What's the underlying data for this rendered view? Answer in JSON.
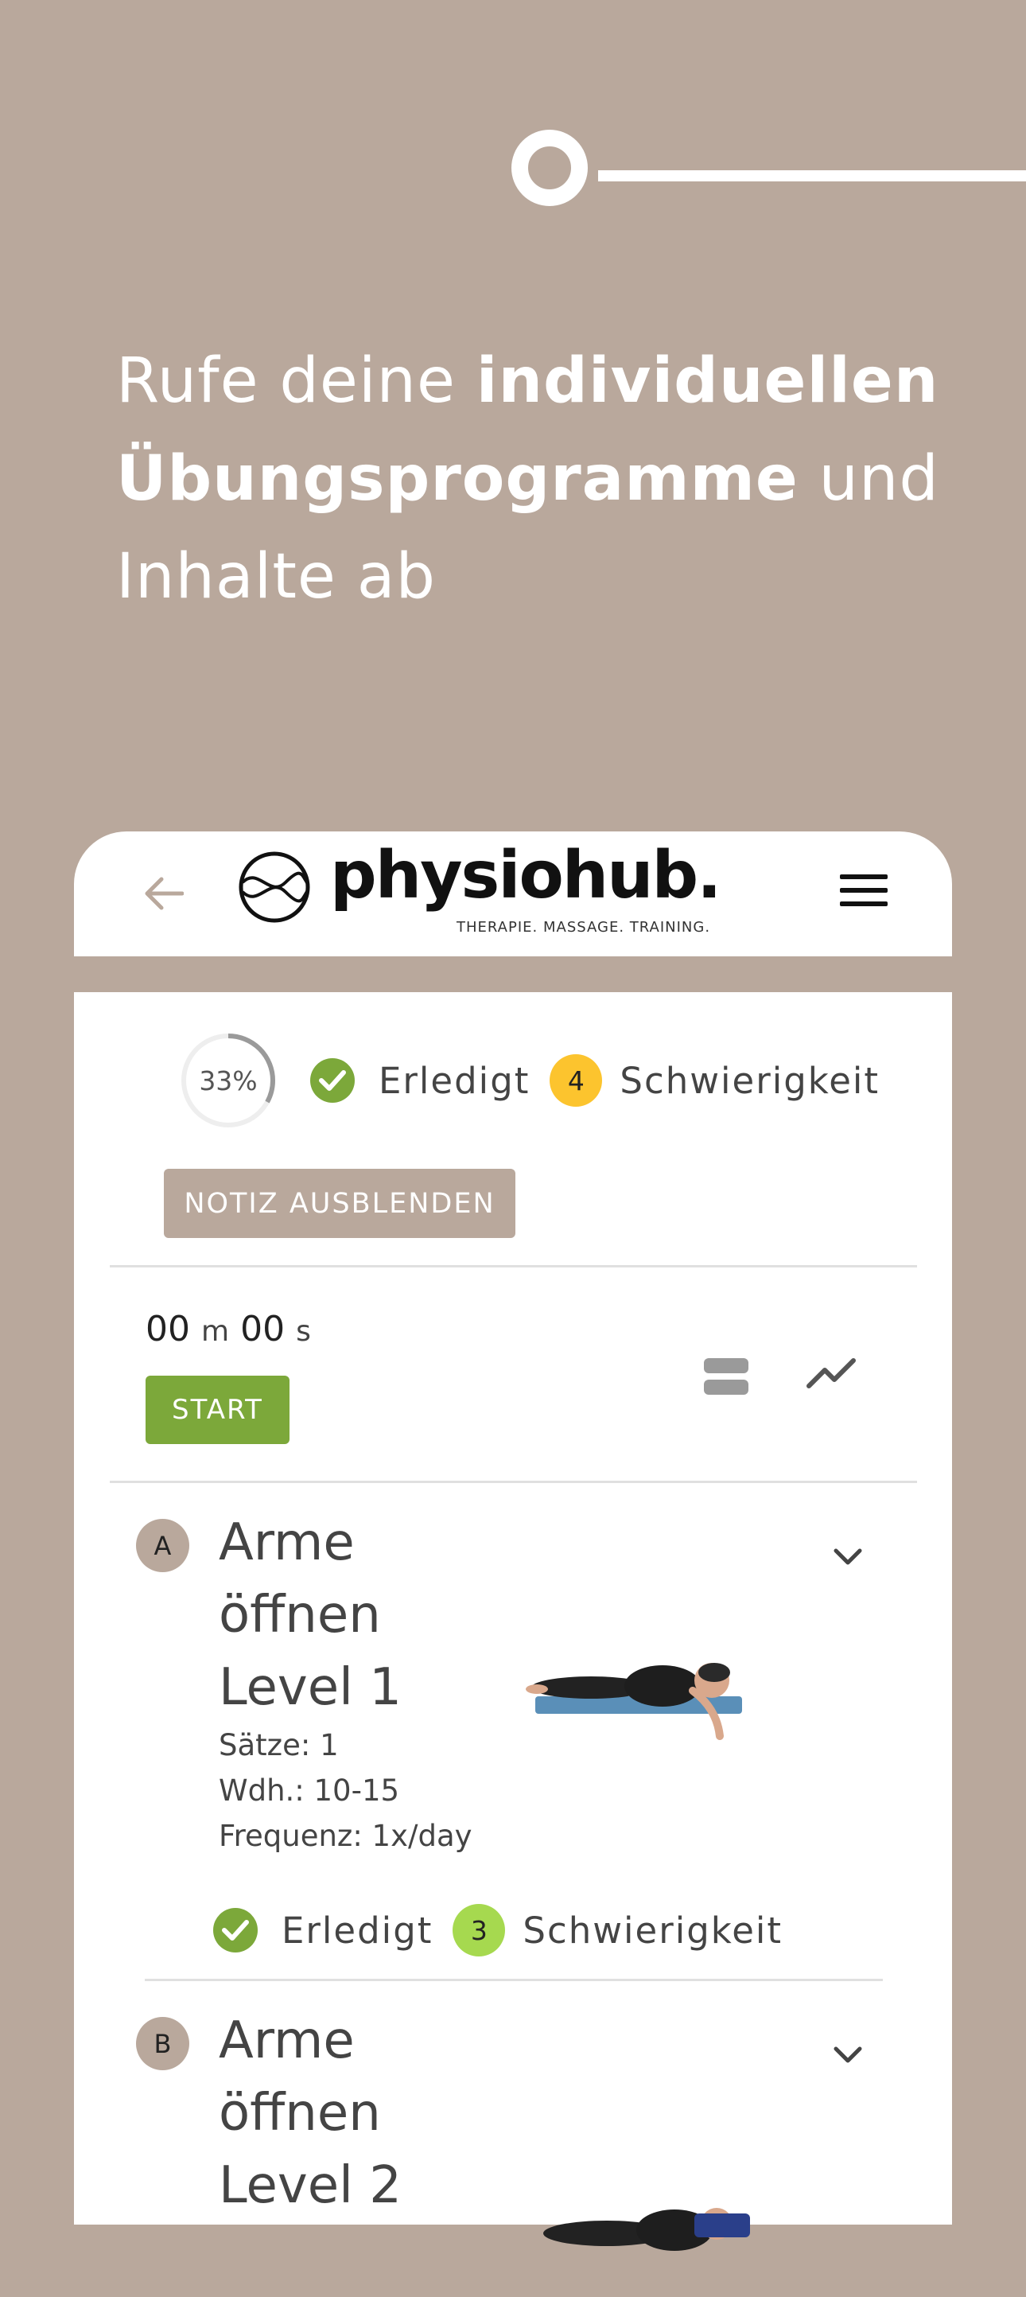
{
  "colors": {
    "background": "#b9a89c",
    "card": "#ffffff",
    "accent_green": "#7ca83a",
    "difficulty_yellow": "#fcc42e",
    "difficulty_lightgreen": "#a6d94f",
    "badge": "#b9a89c"
  },
  "hero": {
    "line1_normal": "Rufe deine ",
    "line1_bold": "individuellen",
    "line2_bold": "Übungsprogramme",
    "line2_normal": " und",
    "line3": "Inhalte ab"
  },
  "header": {
    "back_icon": "arrow-left-icon",
    "logo_text": "physiohub.",
    "logo_tagline": "THERAPIE.  MASSAGE.  TRAINING.",
    "menu_icon": "hamburger-menu-icon"
  },
  "summary": {
    "progress": 0.33,
    "progress_label": "33%",
    "done_label": "Erledigt",
    "difficulty_value": "4",
    "difficulty_label": "Schwierigkeit"
  },
  "note_button": "NOTIZ AUSBLENDEN",
  "timer": {
    "minutes": "00",
    "minutes_unit": "m",
    "seconds": "00",
    "seconds_unit": "s",
    "start_label": "START"
  },
  "exercises": [
    {
      "badge": "A",
      "title": "Arme öffnen Level 1",
      "sets": "Sätze: 1",
      "reps": "Wdh.: 10-15",
      "frequency": "Frequenz: 1x/day",
      "done_label": "Erledigt",
      "difficulty_value": "3",
      "difficulty_label": "Schwierigkeit"
    },
    {
      "badge": "B",
      "title": "Arme öffnen Level 2"
    }
  ]
}
